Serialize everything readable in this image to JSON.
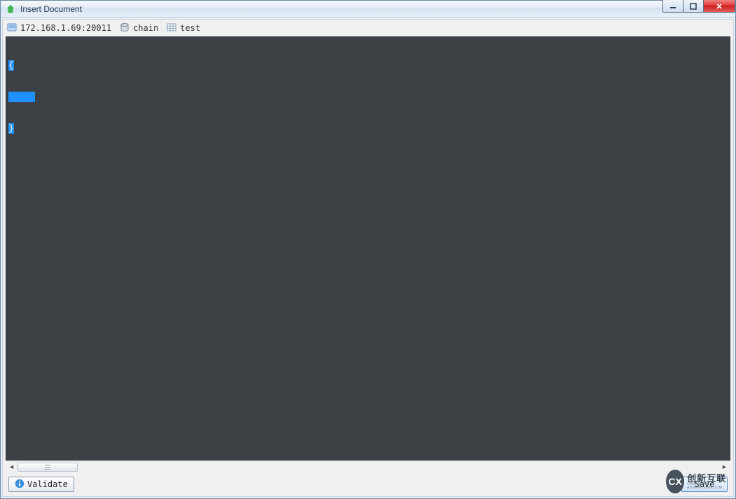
{
  "window": {
    "title": "Insert Document"
  },
  "breadcrumb": {
    "server": "172.168.1.69:20011",
    "database": "chain",
    "collection": "test"
  },
  "editor": {
    "line1": "{",
    "line2": "",
    "line3": "}"
  },
  "footer": {
    "validate_label": "Validate",
    "save_label": "Save"
  },
  "watermark": {
    "glyph": "CX",
    "main": "创新互联",
    "sub": "CHUANGXIN ADVERTISING.COM"
  }
}
